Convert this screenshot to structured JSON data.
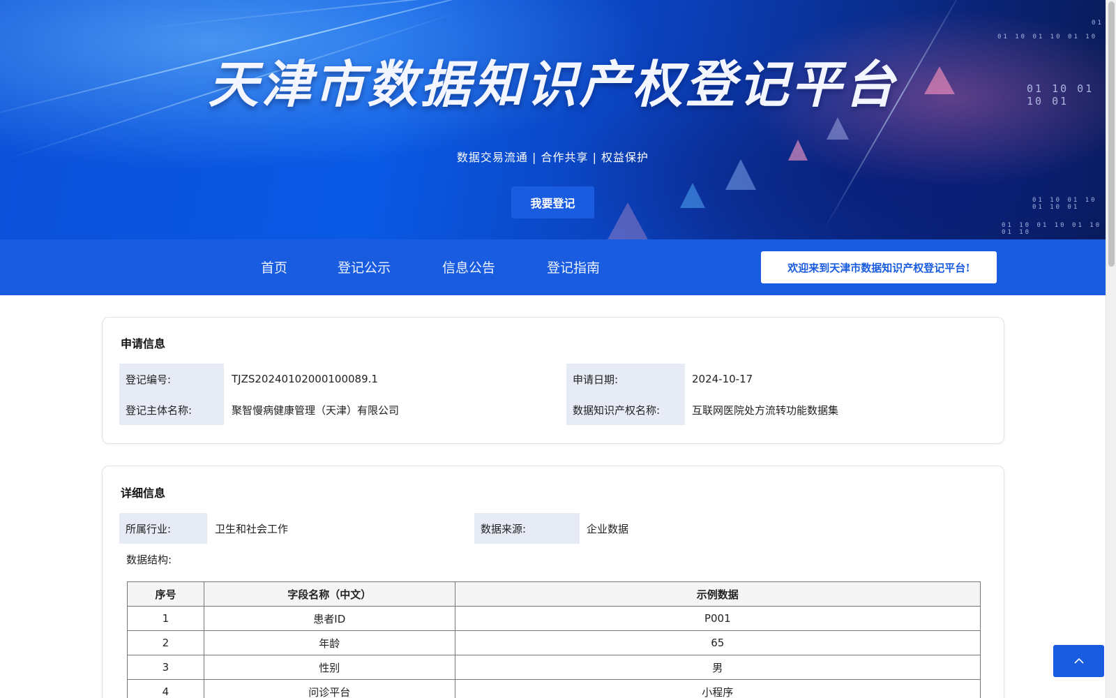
{
  "banner": {
    "title": "天津市数据知识产权登记平台",
    "subtitle": "数据交易流通 | 合作共享 | 权益保护",
    "register_button": "我要登记"
  },
  "nav": {
    "items": [
      "首页",
      "登记公示",
      "信息公告",
      "登记指南"
    ],
    "welcome": "欢迎来到天津市数据知识产权登记平台!"
  },
  "application": {
    "title": "申请信息",
    "reg_no_label": "登记编号:",
    "reg_no_value": "TJZS20240102000100089.1",
    "date_label": "申请日期:",
    "date_value": "2024-10-17",
    "entity_label": "登记主体名称:",
    "entity_value": "聚智慢病健康管理（天津）有限公司",
    "ip_name_label": "数据知识产权名称:",
    "ip_name_value": "互联网医院处方流转功能数据集"
  },
  "detail": {
    "title": "详细信息",
    "industry_label": "所属行业:",
    "industry_value": "卫生和社会工作",
    "source_label": "数据来源:",
    "source_value": "企业数据",
    "structure_label": "数据结构:",
    "table": {
      "headers": [
        "序号",
        "字段名称（中文）",
        "示例数据"
      ],
      "rows": [
        [
          "1",
          "患者ID",
          "P001"
        ],
        [
          "2",
          "年龄",
          "65"
        ],
        [
          "3",
          "性别",
          "男"
        ],
        [
          "4",
          "问诊平台",
          "小程序"
        ]
      ]
    }
  },
  "icons": {
    "back_to_top": "chevron-up-icon"
  }
}
